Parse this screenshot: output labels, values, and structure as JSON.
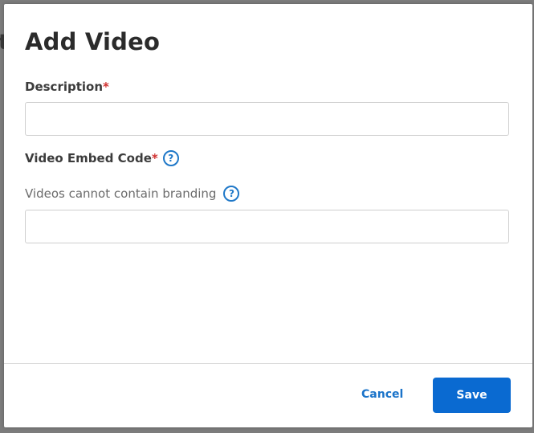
{
  "dialog": {
    "title": "Add Video",
    "description": {
      "label": "Description",
      "required_marker": "*",
      "value": "",
      "placeholder": ""
    },
    "embed_code": {
      "label": "Video Embed Code",
      "required_marker": "*",
      "help_glyph": "?",
      "hint": "Videos cannot contain branding",
      "hint_help_glyph": "?",
      "value": "",
      "placeholder": ""
    },
    "footer": {
      "cancel_label": "Cancel",
      "save_label": "Save"
    }
  },
  "colors": {
    "primary": "#0a6ad1",
    "link": "#1a73c9",
    "required": "#d0302f",
    "help_icon": "#1f78c8",
    "overlay": "#7c7c7c"
  },
  "icons": {
    "help": "question-circle-icon"
  }
}
